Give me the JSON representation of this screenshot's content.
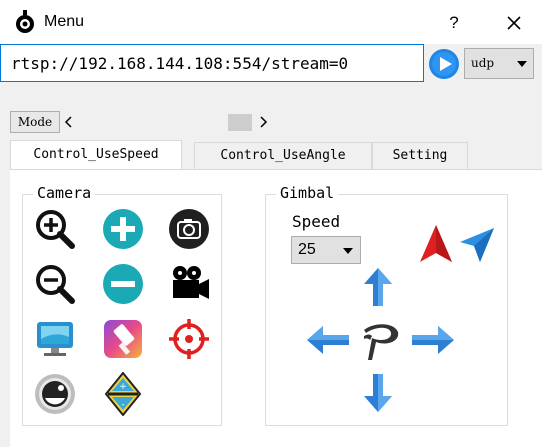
{
  "window": {
    "title": "Menu",
    "help_label": "?",
    "icons": {
      "app": "robot-icon",
      "close": "close-icon"
    }
  },
  "stream": {
    "url": "rtsp://192.168.144.108:554/stream=0",
    "protocol": "udp",
    "play_icon": "play-icon"
  },
  "mode_bar": {
    "label": "Mode"
  },
  "tabs": [
    {
      "label": "Control_UseSpeed",
      "active": true
    },
    {
      "label": "Control_UseAngle",
      "active": false
    },
    {
      "label": "Setting",
      "active": false
    }
  ],
  "camera": {
    "title": "Camera",
    "buttons": [
      "zoom-in-icon",
      "add-icon",
      "camera-icon",
      "zoom-out-icon",
      "remove-icon",
      "video-camera-icon",
      "monitor-icon",
      "paint-brush-icon",
      "target-icon",
      "lens-icon",
      "focus-icon"
    ]
  },
  "gimbal": {
    "title": "Gimbal",
    "speed_label": "Speed",
    "speed_value": "25",
    "buttons": [
      "red-arrow-icon",
      "blue-send-icon",
      "up-arrow-icon",
      "left-arrow-icon",
      "center-logo-icon",
      "right-arrow-icon",
      "down-arrow-icon"
    ]
  },
  "colors": {
    "accent": "#0078d7",
    "teal": "#1ba9b5",
    "red": "#e02020",
    "blue_arrow": "#2d7fd3"
  }
}
